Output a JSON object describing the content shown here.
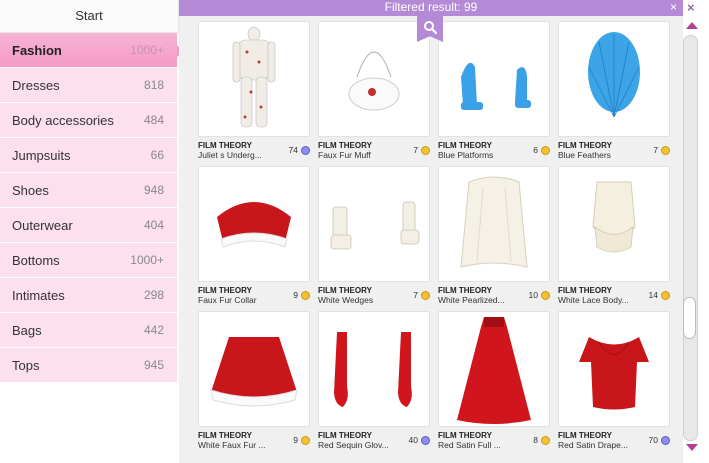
{
  "sidebar": {
    "start_label": "Start",
    "categories": [
      {
        "label": "Fashion",
        "count": "1000+"
      },
      {
        "label": "Dresses",
        "count": "818"
      },
      {
        "label": "Body accessories",
        "count": "484"
      },
      {
        "label": "Jumpsuits",
        "count": "66"
      },
      {
        "label": "Shoes",
        "count": "948"
      },
      {
        "label": "Outerwear",
        "count": "404"
      },
      {
        "label": "Bottoms",
        "count": "1000+"
      },
      {
        "label": "Intimates",
        "count": "298"
      },
      {
        "label": "Bags",
        "count": "442"
      },
      {
        "label": "Tops",
        "count": "945"
      }
    ]
  },
  "header": {
    "filtered_result": "Filtered result: 99",
    "close_glyph": "×"
  },
  "window": {
    "close_glyph": "×"
  },
  "search_icon": "search-icon",
  "colors": {
    "accent": "#b48ad6",
    "active_tab": "#f39ac4",
    "category_bg": "#fde0ee"
  },
  "items": [
    {
      "brand": "FILM THEORY",
      "name": "Juliet s Underg...",
      "price": "74",
      "currency": "star"
    },
    {
      "brand": "FILM THEORY",
      "name": "Faux Fur Muff",
      "price": "7",
      "currency": "gold"
    },
    {
      "brand": "FILM THEORY",
      "name": "Blue Platforms",
      "price": "6",
      "currency": "gold"
    },
    {
      "brand": "FILM THEORY",
      "name": "Blue Feathers",
      "price": "7",
      "currency": "gold"
    },
    {
      "brand": "FILM THEORY",
      "name": "Faux Fur Collar",
      "price": "9",
      "currency": "gold"
    },
    {
      "brand": "FILM THEORY",
      "name": "White Wedges",
      "price": "7",
      "currency": "gold"
    },
    {
      "brand": "FILM THEORY",
      "name": "White Pearlized...",
      "price": "10",
      "currency": "gold"
    },
    {
      "brand": "FILM THEORY",
      "name": "White Lace Body...",
      "price": "14",
      "currency": "gold"
    },
    {
      "brand": "FILM THEORY",
      "name": "White Faux Fur ...",
      "price": "9",
      "currency": "gold"
    },
    {
      "brand": "FILM THEORY",
      "name": "Red Sequin Glov...",
      "price": "40",
      "currency": "star"
    },
    {
      "brand": "FILM THEORY",
      "name": "Red Satin Full ...",
      "price": "8",
      "currency": "gold"
    },
    {
      "brand": "FILM THEORY",
      "name": "Red Satin Drape...",
      "price": "70",
      "currency": "star"
    }
  ]
}
